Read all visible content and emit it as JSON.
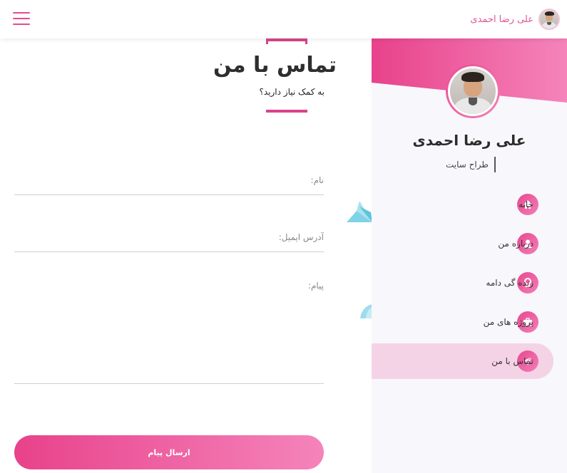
{
  "header": {
    "user_name": "علی رضا احمدی"
  },
  "sidebar": {
    "profile_name": "علی رضا احمدی",
    "profile_role": "طراح سایت",
    "items": [
      {
        "label": "خانه",
        "icon": "home-icon",
        "active": false
      },
      {
        "label": "درباره من",
        "icon": "user-icon",
        "active": false
      },
      {
        "label": "زنده گی دامه",
        "icon": "award-icon",
        "active": false
      },
      {
        "label": "پروژه های من",
        "icon": "briefcase-icon",
        "active": false
      },
      {
        "label": "تماس با من",
        "icon": "paper-plane-icon",
        "active": true
      }
    ]
  },
  "contact": {
    "title": "تماس با من",
    "subtitle": "به کمک نیاز دارید؟",
    "name_placeholder": "نام:",
    "email_placeholder": "آدرس ایمیل:",
    "message_placeholder": "پیام:",
    "submit_label": "ارسال پیام"
  },
  "colors": {
    "accent": "#e84a8c",
    "accent_light": "#f584bb",
    "active_bg": "#f5d3e6",
    "sidebar_bg": "#f8f7fb"
  }
}
